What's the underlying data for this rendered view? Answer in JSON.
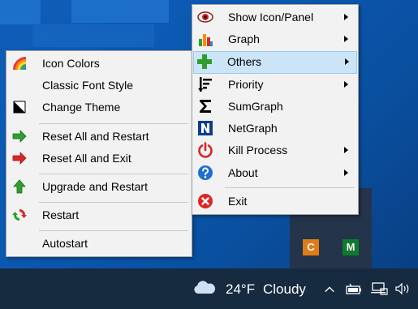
{
  "tray_apps": [
    {
      "letter": "C",
      "color": "#e07b17"
    },
    {
      "letter": "M",
      "color": "#0f7a2e"
    }
  ],
  "left_menu": {
    "items": [
      {
        "label": "Icon Colors",
        "icon": "rainbow-icon"
      },
      {
        "label": "Classic Font Style",
        "icon": ""
      },
      {
        "label": "Change Theme",
        "icon": "theme-icon"
      },
      {
        "label": "Reset All and Restart",
        "icon": "green-arrow-right-icon"
      },
      {
        "label": "Reset All and Exit",
        "icon": "red-arrow-right-icon"
      },
      {
        "label": "Upgrade and Restart",
        "icon": "green-arrow-up-icon"
      },
      {
        "label": "Restart",
        "icon": "refresh-icon"
      },
      {
        "label": "Autostart",
        "icon": ""
      }
    ]
  },
  "right_menu": {
    "items": [
      {
        "label": "Show Icon/Panel",
        "icon": "eye-icon",
        "submenu": true
      },
      {
        "label": "Graph",
        "icon": "bar-chart-icon",
        "submenu": true
      },
      {
        "label": "Others",
        "icon": "plus-icon",
        "submenu": true,
        "selected": true
      },
      {
        "label": "Priority",
        "icon": "priority-icon",
        "submenu": true
      },
      {
        "label": "SumGraph",
        "icon": "sigma-icon",
        "submenu": false
      },
      {
        "label": "NetGraph",
        "icon": "n-icon",
        "submenu": false
      },
      {
        "label": "Kill Process",
        "icon": "power-icon",
        "submenu": true
      },
      {
        "label": "About",
        "icon": "help-icon",
        "submenu": true
      },
      {
        "label": "Exit",
        "icon": "close-circle-icon",
        "submenu": false
      }
    ]
  },
  "taskbar": {
    "weather_temp": "24°F",
    "weather_condition": "Cloudy"
  },
  "colors": {
    "menu_bg": "#f2f2f2",
    "selected_bg": "#cce4f7",
    "taskbar_bg": "#162a40",
    "desktop_bg": "#0b58b0"
  }
}
